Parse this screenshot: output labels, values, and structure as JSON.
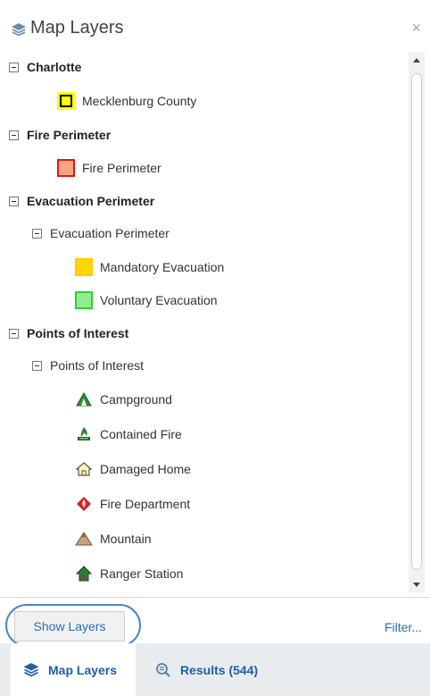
{
  "header": {
    "title": "Map Layers",
    "close_label": "×"
  },
  "tree": {
    "charlotte": {
      "label": "Charlotte",
      "items": [
        {
          "label": "Mecklenburg County",
          "icon": "county-swatch-icon"
        }
      ]
    },
    "fire_perimeter": {
      "label": "Fire Perimeter",
      "items": [
        {
          "label": "Fire Perimeter",
          "icon": "fire-perimeter-swatch-icon"
        }
      ]
    },
    "evacuation": {
      "label": "Evacuation Perimeter",
      "sub_label": "Evacuation Perimeter",
      "items": [
        {
          "label": "Mandatory Evacuation",
          "icon": "mandatory-evacuation-swatch-icon"
        },
        {
          "label": "Voluntary Evacuation",
          "icon": "voluntary-evacuation-swatch-icon"
        }
      ]
    },
    "poi": {
      "label": "Points of Interest",
      "sub_label": "Points of Interest",
      "items": [
        {
          "label": "Campground",
          "icon": "campground-icon"
        },
        {
          "label": "Contained Fire",
          "icon": "contained-fire-icon"
        },
        {
          "label": "Damaged Home",
          "icon": "damaged-home-icon"
        },
        {
          "label": "Fire Department",
          "icon": "fire-department-icon"
        },
        {
          "label": "Mountain",
          "icon": "mountain-icon"
        },
        {
          "label": "Ranger Station",
          "icon": "ranger-station-icon"
        }
      ]
    }
  },
  "footer": {
    "show_layers_label": "Show Layers",
    "filter_label": "Filter..."
  },
  "tabs": {
    "map_layers": "Map Layers",
    "results": "Results (544)"
  },
  "colors": {
    "accent": "#1f5fa6",
    "county_fill": "#ffff00",
    "fire_perimeter_fill": "#f4a582",
    "fire_perimeter_border": "#d7191c",
    "mandatory_fill": "#ffd700",
    "voluntary_fill": "#90ee90",
    "voluntary_border": "#33cc33"
  }
}
